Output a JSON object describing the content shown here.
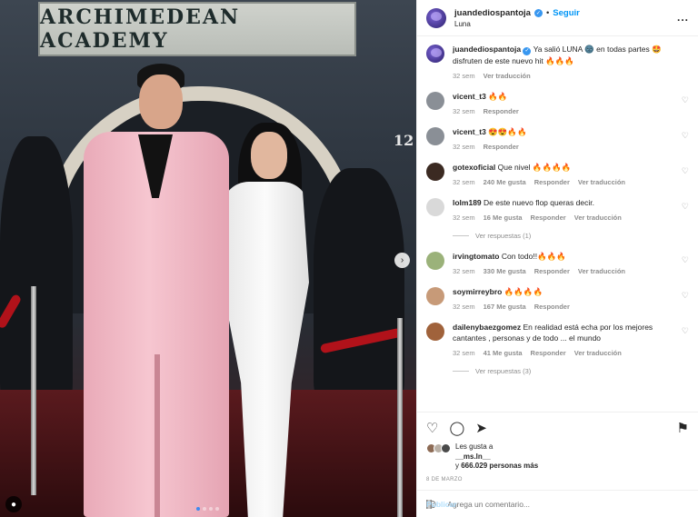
{
  "photo": {
    "sign_text": "ARCHIMEDEAN ACADEMY",
    "wall_number": "12",
    "carousel_slides": 4,
    "carousel_active": 1
  },
  "header": {
    "username": "juandediospantoja",
    "follow_label": "Seguir",
    "separator": "•",
    "location": "Luna",
    "more_label": "..."
  },
  "caption": {
    "username": "juandediospantoja",
    "text": "Ya salió LUNA 🌚 en todas partes 🤩 disfruten de este nuevo hit 🔥🔥🔥",
    "time": "32 sem",
    "translate": "Ver traducción"
  },
  "comments": [
    {
      "username": "vicent_t3",
      "text": "🔥🔥",
      "time": "32 sem",
      "likes": "",
      "reply": "Responder",
      "translate": "",
      "replies": "",
      "avatar_color": "#8a8f96"
    },
    {
      "username": "vicent_t3",
      "text": "😍😍🔥🔥",
      "time": "32 sem",
      "likes": "",
      "reply": "Responder",
      "translate": "",
      "replies": "",
      "avatar_color": "#8a8f96"
    },
    {
      "username": "gotexoficial",
      "text": "Que nivel 🔥🔥🔥🔥",
      "time": "32 sem",
      "likes": "240 Me gusta",
      "reply": "Responder",
      "translate": "Ver traducción",
      "replies": "",
      "avatar_color": "#3b2a22"
    },
    {
      "username": "lolm189",
      "text": "De este nuevo flop queras decir.",
      "time": "32 sem",
      "likes": "16 Me gusta",
      "reply": "Responder",
      "translate": "Ver traducción",
      "replies": "Ver respuestas (1)",
      "avatar_color": "#d9d9d9"
    },
    {
      "username": "irvingtomato",
      "text": "Con todo!!🔥🔥🔥",
      "time": "32 sem",
      "likes": "330 Me gusta",
      "reply": "Responder",
      "translate": "Ver traducción",
      "replies": "",
      "avatar_color": "#9bb27a"
    },
    {
      "username": "soymirreybro",
      "text": "🔥🔥🔥🔥",
      "time": "32 sem",
      "likes": "167 Me gusta",
      "reply": "Responder",
      "translate": "",
      "replies": "",
      "avatar_color": "#c79a78"
    },
    {
      "username": "daileny​baezgomez",
      "text": "En realidad está echa por los mejores cantantes , personas y de todo ... el mundo",
      "time": "32 sem",
      "likes": "41 Me gusta",
      "reply": "Responder",
      "translate": "Ver traducción",
      "replies": "Ver respuestas (3)",
      "avatar_color": "#a0623b"
    }
  ],
  "actions": {
    "like_icon": "heart-icon",
    "comment_icon": "comment-icon",
    "share_icon": "share-icon",
    "save_icon": "bookmark-icon"
  },
  "likes": {
    "prefix": "Les gusta a",
    "user": "__ms.ln__",
    "joiner": "y",
    "count": "666.029 personas más"
  },
  "date": "8 DE MARZO",
  "add_comment": {
    "placeholder": "Agrega un comentario...",
    "post_label": "Publicar"
  },
  "colors": {
    "accent": "#0095f6",
    "verified": "#3897f0",
    "muted": "#8e8e8e",
    "carousel_dot_active": "#3d8af0"
  }
}
